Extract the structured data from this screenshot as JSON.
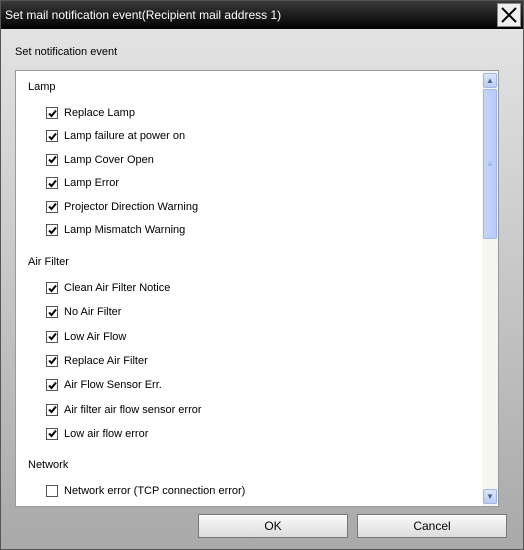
{
  "window": {
    "title": "Set mail notification event(Recipient mail address 1)",
    "close_icon": "close-icon"
  },
  "subtitle": "Set notification event",
  "groups": [
    {
      "label": "Lamp",
      "items": [
        {
          "label": "Replace Lamp",
          "checked": true
        },
        {
          "label": "Lamp failure at power on",
          "checked": true
        },
        {
          "label": "Lamp Cover Open",
          "checked": true
        },
        {
          "label": "Lamp Error",
          "checked": true
        },
        {
          "label": "Projector Direction Warning",
          "checked": true
        },
        {
          "label": "Lamp Mismatch Warning",
          "checked": true
        }
      ]
    },
    {
      "label": "Air Filter",
      "items": [
        {
          "label": "Clean Air Filter Notice",
          "checked": true
        },
        {
          "label": "No Air Filter",
          "checked": true
        },
        {
          "label": "Low Air Flow",
          "checked": true
        },
        {
          "label": "Replace Air Filter",
          "checked": true
        },
        {
          "label": "Air Flow Sensor Err.",
          "checked": true
        },
        {
          "label": "Air filter air flow sensor error",
          "checked": true
        },
        {
          "label": "Low air flow error",
          "checked": true
        }
      ]
    },
    {
      "label": "Network",
      "items": [
        {
          "label": "Network error (TCP connection error)",
          "checked": false
        }
      ]
    }
  ],
  "buttons": {
    "ok": "OK",
    "cancel": "Cancel"
  }
}
